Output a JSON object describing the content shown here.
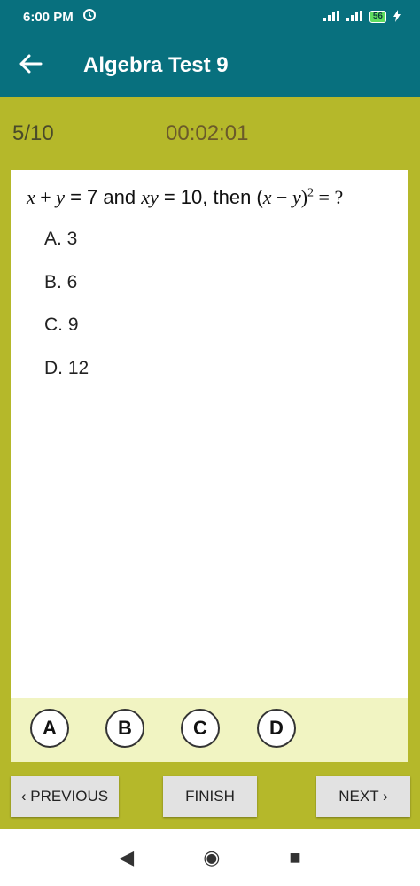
{
  "status_bar": {
    "time": "6:00 PM",
    "battery": "56",
    "icons": [
      "alarm-icon",
      "signal-icon",
      "signal-icon",
      "battery-icon",
      "charging-icon"
    ]
  },
  "app_bar": {
    "title": "Algebra Test 9",
    "back_icon": "back-arrow-icon"
  },
  "progress": {
    "count": "5/10",
    "timer": "00:02:01"
  },
  "question": {
    "parts": {
      "p1": "x",
      "p2": " + ",
      "p3": "y",
      "p4": " = 7 and ",
      "p5": "xy",
      "p6": " = 10, then (",
      "p7": "x",
      "p8": " − ",
      "p9": "y",
      "p10": ")",
      "sup": "2",
      "p11": " = ?"
    },
    "options": [
      "A. 3",
      "B. 6",
      "C. 9",
      "D. 12"
    ]
  },
  "answers": [
    "A",
    "B",
    "C",
    "D"
  ],
  "buttons": {
    "previous": "‹ PREVIOUS",
    "finish": "FINISH",
    "next": "NEXT ›"
  },
  "nav": {
    "back": "◀",
    "home": "◉",
    "recents": "■"
  },
  "colors": {
    "primary": "#08707e",
    "background": "#b5b82a",
    "answer_strip": "#f1f4c2",
    "button": "#e2e2e2"
  }
}
